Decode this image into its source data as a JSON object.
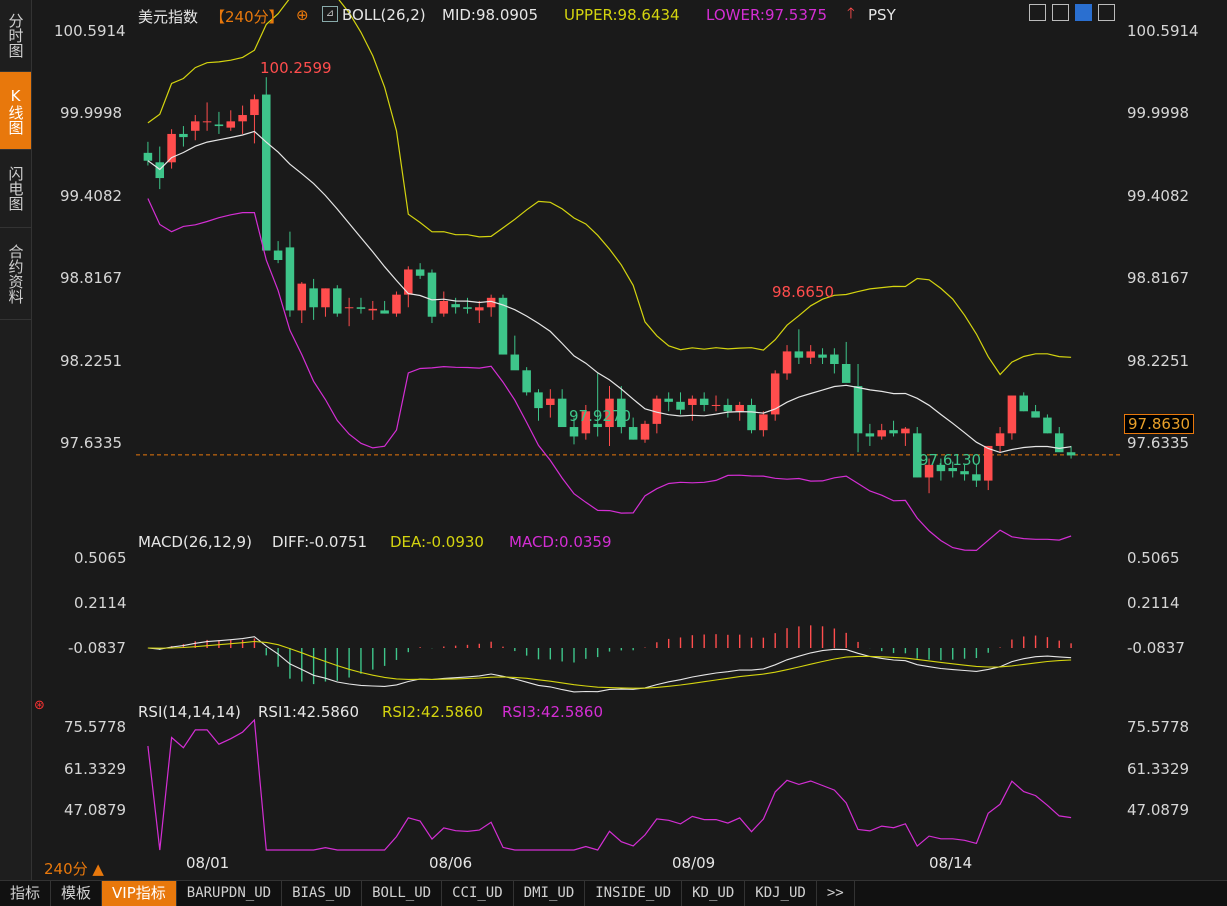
{
  "sidebar": {
    "items": [
      {
        "label": "分时图"
      },
      {
        "label": "K线图",
        "active": true
      },
      {
        "label": "闪电图"
      },
      {
        "label": "合约资料"
      }
    ]
  },
  "header": {
    "symbol": "美元指数",
    "period": "【240分】",
    "add_icon": "⊕",
    "boll_label": "BOLL(26,2)",
    "boll_mid": "MID:98.0905",
    "boll_upper": "UPPER:98.6434",
    "boll_lower": "LOWER:97.5375",
    "psy_label": "PSY"
  },
  "colors": {
    "up": "#ff4d4d",
    "down": "#3ec58a",
    "mid": "#e6e6e6",
    "upper": "#d4d40f",
    "lower": "#d42ed4",
    "accent": "#e8780c",
    "cross": "#e8a02a"
  },
  "price_axis": {
    "labels": [
      "100.5914",
      "99.9998",
      "99.4082",
      "98.8167",
      "98.2251",
      "97.6335"
    ],
    "current": "97.8630"
  },
  "annotations": {
    "high": "100.2599",
    "local_high": "98.6650",
    "local_low1": "97.9270",
    "low": "97.6130"
  },
  "macd": {
    "label": "MACD(26,12,9)",
    "diff": "DIFF:-0.0751",
    "dea": "DEA:-0.0930",
    "macd": "MACD:0.0359",
    "axis": [
      "0.5065",
      "0.2114",
      "-0.0837"
    ]
  },
  "rsi": {
    "label": "RSI(14,14,14)",
    "rsi1": "RSI1:42.5860",
    "rsi2": "RSI2:42.5860",
    "rsi3": "RSI3:42.5860",
    "axis": [
      "75.5778",
      "61.3329",
      "47.0879"
    ]
  },
  "time_axis": {
    "labels": [
      "08/01",
      "08/06",
      "08/09",
      "08/14"
    ],
    "period_label": "240分 ▲"
  },
  "bottom_tabs": [
    "指标",
    "模板",
    "VIP指标",
    "BARUPDN_UD",
    "BIAS_UD",
    "BOLL_UD",
    "CCI_UD",
    "DMI_UD",
    "INSIDE_UD",
    "KD_UD",
    "KDJ_UD",
    ">>"
  ],
  "chart_data": {
    "type": "candlestick",
    "ylim": [
      97.45,
      100.75
    ],
    "candles": [
      [
        99.78,
        99.85,
        99.7,
        99.73
      ],
      [
        99.72,
        99.82,
        99.55,
        99.62
      ],
      [
        99.72,
        99.93,
        99.68,
        99.9
      ],
      [
        99.9,
        99.95,
        99.82,
        99.88
      ],
      [
        99.92,
        100.02,
        99.86,
        99.98
      ],
      [
        99.98,
        100.1,
        99.92,
        99.98
      ],
      [
        99.96,
        100.04,
        99.9,
        99.95
      ],
      [
        99.94,
        100.05,
        99.92,
        99.98
      ],
      [
        99.98,
        100.08,
        99.9,
        100.02
      ],
      [
        100.02,
        100.15,
        99.84,
        100.12
      ],
      [
        100.15,
        100.26,
        99.9,
        99.16
      ],
      [
        99.16,
        99.22,
        99.08,
        99.1
      ],
      [
        99.18,
        99.28,
        98.74,
        98.78
      ],
      [
        98.78,
        98.96,
        98.7,
        98.95
      ],
      [
        98.92,
        98.98,
        98.72,
        98.8
      ],
      [
        98.8,
        98.92,
        98.74,
        98.92
      ],
      [
        98.92,
        98.94,
        98.74,
        98.76
      ],
      [
        98.8,
        98.86,
        98.68,
        98.8
      ],
      [
        98.8,
        98.86,
        98.76,
        98.79
      ],
      [
        98.78,
        98.84,
        98.72,
        98.79
      ],
      [
        98.78,
        98.84,
        98.76,
        98.76
      ],
      [
        98.76,
        98.9,
        98.74,
        98.88
      ],
      [
        98.88,
        99.06,
        98.8,
        99.04
      ],
      [
        99.04,
        99.08,
        98.98,
        99.0
      ],
      [
        99.02,
        99.04,
        98.7,
        98.74
      ],
      [
        98.76,
        98.9,
        98.74,
        98.84
      ],
      [
        98.82,
        98.86,
        98.76,
        98.8
      ],
      [
        98.8,
        98.86,
        98.76,
        98.79
      ],
      [
        98.78,
        98.84,
        98.7,
        98.8
      ],
      [
        98.8,
        98.88,
        98.74,
        98.86
      ],
      [
        98.86,
        98.88,
        98.5,
        98.5
      ],
      [
        98.5,
        98.62,
        98.46,
        98.4
      ],
      [
        98.4,
        98.42,
        98.24,
        98.26
      ],
      [
        98.26,
        98.28,
        98.08,
        98.16
      ],
      [
        98.18,
        98.28,
        98.1,
        98.22
      ],
      [
        98.22,
        98.28,
        98.06,
        98.04
      ],
      [
        98.04,
        98.1,
        97.93,
        97.98
      ],
      [
        98.0,
        98.18,
        97.96,
        98.14
      ],
      [
        98.06,
        98.38,
        97.98,
        98.04
      ],
      [
        98.04,
        98.3,
        97.92,
        98.22
      ],
      [
        98.22,
        98.3,
        98.0,
        98.04
      ],
      [
        98.04,
        98.1,
        97.96,
        97.96
      ],
      [
        97.96,
        98.08,
        97.94,
        98.06
      ],
      [
        98.06,
        98.24,
        98.0,
        98.22
      ],
      [
        98.22,
        98.26,
        98.14,
        98.2
      ],
      [
        98.2,
        98.26,
        98.12,
        98.15
      ],
      [
        98.18,
        98.24,
        98.08,
        98.22
      ],
      [
        98.22,
        98.26,
        98.14,
        98.18
      ],
      [
        98.18,
        98.24,
        98.14,
        98.18
      ],
      [
        98.18,
        98.22,
        98.1,
        98.14
      ],
      [
        98.14,
        98.2,
        98.08,
        98.18
      ],
      [
        98.18,
        98.22,
        98.0,
        98.02
      ],
      [
        98.02,
        98.14,
        97.98,
        98.12
      ],
      [
        98.12,
        98.4,
        98.08,
        98.38
      ],
      [
        98.38,
        98.56,
        98.34,
        98.52
      ],
      [
        98.52,
        98.66,
        98.44,
        98.48
      ],
      [
        98.48,
        98.56,
        98.44,
        98.52
      ],
      [
        98.5,
        98.54,
        98.44,
        98.48
      ],
      [
        98.5,
        98.54,
        98.38,
        98.44
      ],
      [
        98.44,
        98.58,
        98.38,
        98.32
      ],
      [
        98.3,
        98.44,
        97.88,
        98.0
      ],
      [
        98.0,
        98.06,
        97.92,
        97.98
      ],
      [
        97.98,
        98.06,
        97.96,
        98.02
      ],
      [
        98.02,
        98.08,
        97.98,
        98.0
      ],
      [
        98.0,
        98.04,
        97.92,
        98.03
      ],
      [
        98.0,
        98.04,
        97.72,
        97.72
      ],
      [
        97.72,
        97.84,
        97.62,
        97.8
      ],
      [
        97.8,
        97.84,
        97.7,
        97.76
      ],
      [
        97.78,
        97.82,
        97.72,
        97.76
      ],
      [
        97.76,
        97.8,
        97.7,
        97.74
      ],
      [
        97.74,
        97.8,
        97.66,
        97.7
      ],
      [
        97.7,
        97.92,
        97.64,
        97.92
      ],
      [
        97.92,
        98.04,
        97.88,
        98.0
      ],
      [
        98.0,
        98.24,
        97.96,
        98.24
      ],
      [
        98.24,
        98.26,
        98.14,
        98.14
      ],
      [
        98.14,
        98.18,
        98.1,
        98.1
      ],
      [
        98.1,
        98.12,
        98.0,
        98.0
      ],
      [
        98.0,
        98.04,
        97.9,
        97.88
      ],
      [
        97.88,
        97.92,
        97.84,
        97.86
      ]
    ],
    "boll_mid_note": "MID:98.0905",
    "boll_upper_note": "UPPER:98.6434",
    "boll_lower_note": "LOWER:97.5375"
  }
}
